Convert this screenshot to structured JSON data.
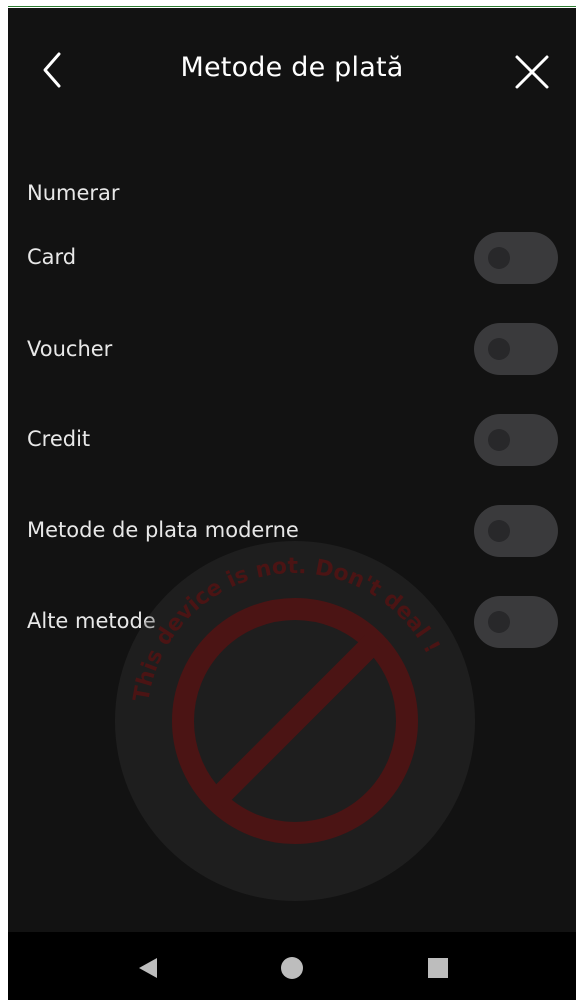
{
  "header": {
    "title": "Metode de plată",
    "back_icon": "chevron-left-icon",
    "close_icon": "close-icon"
  },
  "payment_methods": {
    "section_label": "Numerar",
    "items": [
      {
        "label": "Card",
        "enabled": false
      },
      {
        "label": "Voucher",
        "enabled": false
      },
      {
        "label": "Credit",
        "enabled": false
      },
      {
        "label": "Metode de plata moderne",
        "enabled": false
      },
      {
        "label": "Alte metode",
        "enabled": false
      }
    ]
  },
  "watermark": {
    "text": "This device is not. Don't deal !",
    "icon": "prohibited-icon"
  },
  "navbar": {
    "back_icon": "triangle-back-icon",
    "home_icon": "circle-home-icon",
    "recents_icon": "square-recents-icon"
  },
  "colors": {
    "background": "#121212",
    "text": "#e8e8e8",
    "toggle_track": "#3a3a3c",
    "watermark_red": "#8b1a1a",
    "navbar": "#000000"
  }
}
